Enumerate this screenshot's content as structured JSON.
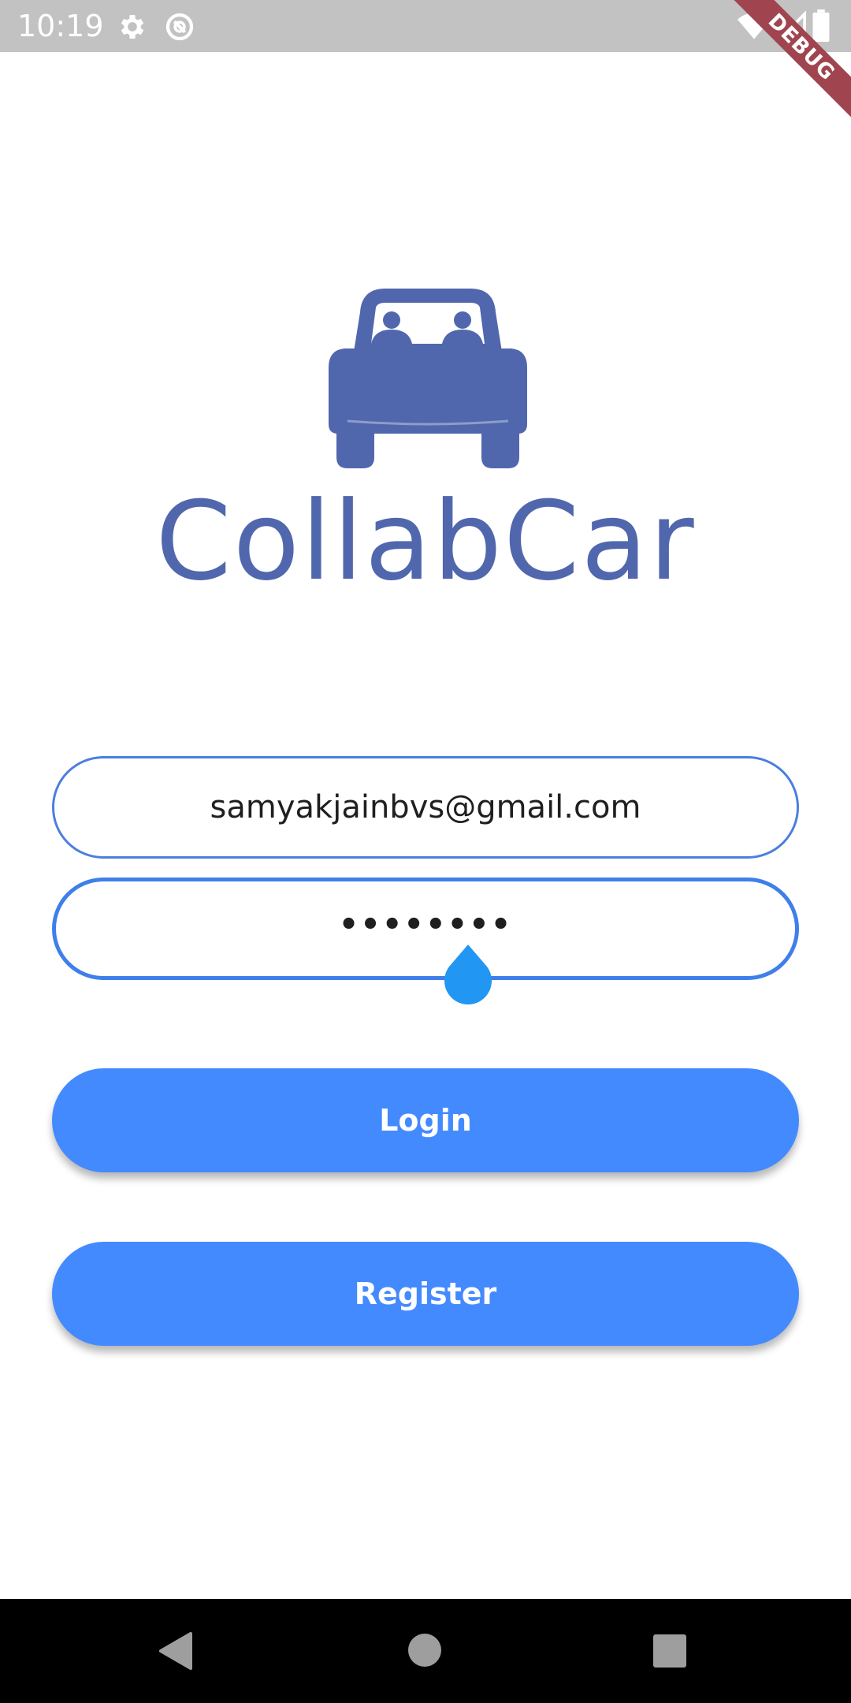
{
  "status_bar": {
    "time": "10:19",
    "icons": [
      "gear-icon",
      "sync-icon",
      "wifi-icon",
      "signal-icon",
      "battery-icon"
    ]
  },
  "debug_banner": "DEBUG",
  "logo": {
    "icon": "car-with-passengers-icon",
    "text": "CollabCar",
    "color": "#5167ad"
  },
  "login_form": {
    "email": {
      "value": "samyakjainbvs@gmail.com"
    },
    "password": {
      "masked_value": "••••••••"
    },
    "login_label": "Login",
    "register_label": "Register"
  },
  "colors": {
    "accent": "#448aff",
    "field_border": "#3f7fea",
    "caret_handle": "#2196f3"
  },
  "nav_bar": {
    "icons": [
      "back-icon",
      "home-icon",
      "recents-icon"
    ]
  }
}
